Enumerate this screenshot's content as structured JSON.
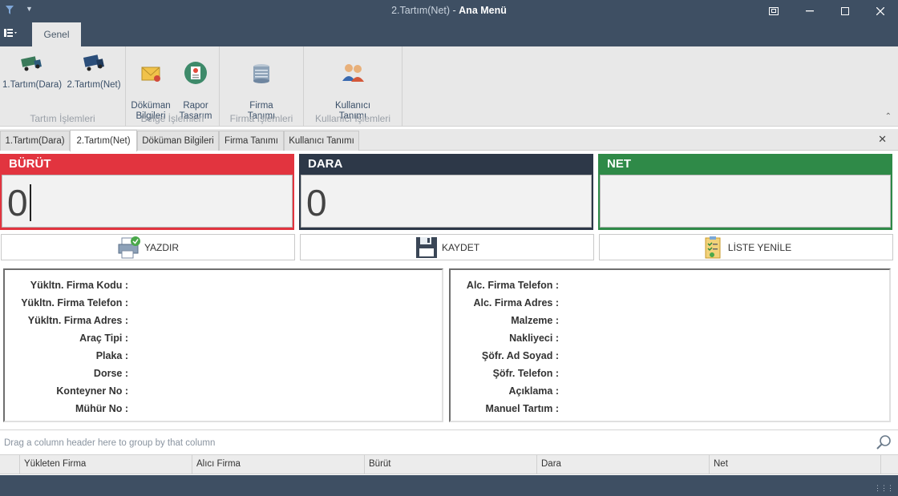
{
  "window": {
    "doc_title": "2.Tartım(Net)",
    "separator": " - ",
    "app_title": "Ana Menü"
  },
  "ribbon": {
    "tabs": [
      {
        "label": "Genel"
      }
    ],
    "groups": [
      {
        "caption": "Tartım İşlemleri",
        "items": [
          {
            "label": "1.Tartım(Dara)",
            "icon": "truck-icon"
          },
          {
            "label": "2.Tartım(Net)",
            "icon": "truck-icon"
          }
        ]
      },
      {
        "caption": "Belge İşlemleri",
        "items": [
          {
            "label": "Döküman\nBilgileri",
            "icon": "envelope-icon"
          },
          {
            "label": "Rapor\nTasarım",
            "icon": "report-icon"
          }
        ]
      },
      {
        "caption": "Firma İşlemleri",
        "items": [
          {
            "label": "Firma\nTanımı",
            "icon": "building-icon"
          }
        ]
      },
      {
        "caption": "Kullanıcı İşlemleri",
        "items": [
          {
            "label": "Kullanıcı\nTanımı",
            "icon": "users-icon"
          }
        ]
      }
    ]
  },
  "doc_tabs": [
    {
      "label": "1.Tartım(Dara)"
    },
    {
      "label": "2.Tartım(Net)",
      "active": true
    },
    {
      "label": "Döküman Bilgileri"
    },
    {
      "label": "Firma Tanımı"
    },
    {
      "label": "Kullanıcı Tanımı"
    }
  ],
  "weights": {
    "gross": {
      "label": "BÜRÜT",
      "value": "0",
      "color": "#e2343f"
    },
    "tare": {
      "label": "DARA",
      "value": "0",
      "color": "#2d3848"
    },
    "net": {
      "label": "NET",
      "value": "",
      "color": "#2f8a48"
    }
  },
  "actions": {
    "print": "YAZDIR",
    "save": "KAYDET",
    "refresh": "LİSTE YENİLE"
  },
  "info_left": [
    "Yükltn. Firma Kodu :",
    "Yükltn. Firma Telefon :",
    "Yükltn. Firma Adres :",
    "Araç Tipi :",
    "Plaka :",
    "Dorse :",
    "Konteyner No :",
    "Mühür No :"
  ],
  "info_right": [
    "Alc. Firma Telefon :",
    "Alc. Firma Adres :",
    "Malzeme :",
    "Nakliyeci :",
    "Şöfr. Ad Soyad :",
    "Şöfr. Telefon :",
    "Açıklama :",
    "Manuel Tartım :"
  ],
  "grid": {
    "group_hint": "Drag a column header here to group by that column",
    "columns": [
      "Yükleten Firma",
      "Alıcı Firma",
      "Bürüt",
      "Dara",
      "Net"
    ]
  }
}
